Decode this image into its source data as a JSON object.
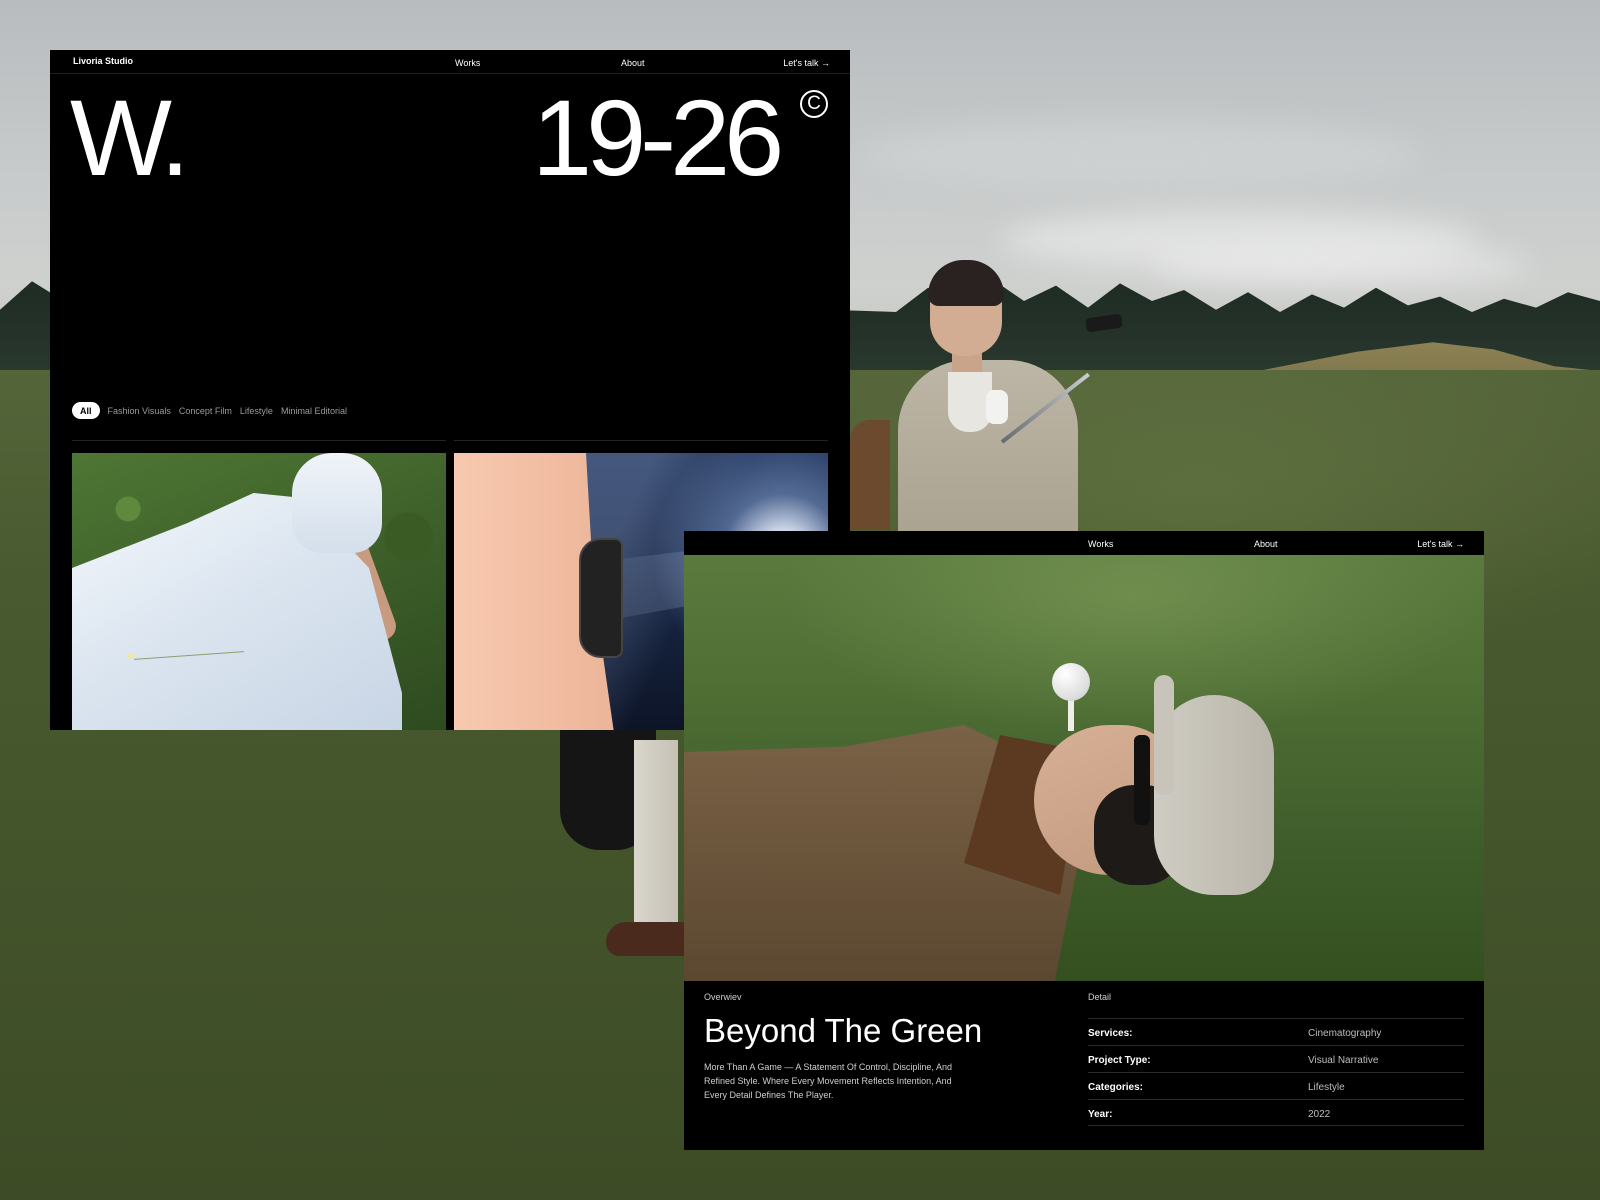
{
  "works_panel": {
    "brand": "Livoria Studio",
    "nav": {
      "works": "Works",
      "about": "About",
      "cta": "Let's talk →"
    },
    "hero_letter": "W.",
    "hero_years": "19-26",
    "copyright_symbol": "C",
    "filters": {
      "active": "All",
      "items": [
        "Fashion Visuals",
        "Concept Film",
        "Lifestyle",
        "Minimal Editorial"
      ]
    }
  },
  "project_panel": {
    "nav": {
      "works": "Works",
      "about": "About",
      "cta": "Let's talk →"
    },
    "overview_label": "Overwiev",
    "detail_label": "Detail",
    "title": "Beyond The Green",
    "description": "More Than A Game — A Statement Of Control, Discipline, And Refined Style. Where Every Movement Reflects Intention, And Every Detail Defines The Player.",
    "details": [
      {
        "key": "Services:",
        "value": "Cinematography"
      },
      {
        "key": "Project Type:",
        "value": "Visual Narrative"
      },
      {
        "key": "Categories:",
        "value": "Lifestyle"
      },
      {
        "key": "Year:",
        "value": "2022"
      }
    ]
  },
  "colors": {
    "panel_bg": "#000000",
    "text_primary": "#ffffff",
    "text_muted": "#9a9a9a",
    "pill_bg": "#ffffff",
    "grass_bg": "#44542e"
  }
}
